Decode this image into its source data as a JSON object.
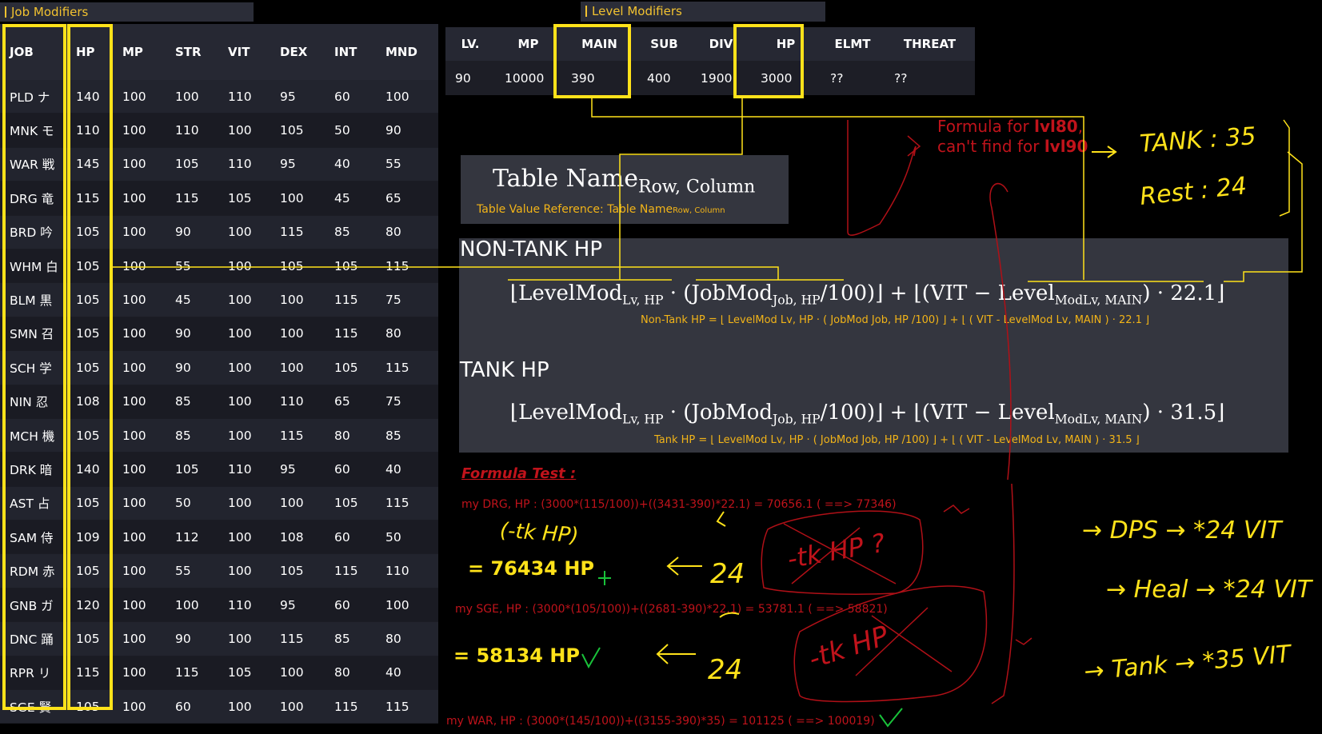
{
  "job_panel": {
    "title": "Job Modifiers",
    "columns": [
      "JOB",
      "HP",
      "MP",
      "STR",
      "VIT",
      "DEX",
      "INT",
      "MND"
    ],
    "rows": [
      [
        "PLD ナ",
        "140",
        "100",
        "100",
        "110",
        "95",
        "60",
        "100"
      ],
      [
        "MNK モ",
        "110",
        "100",
        "110",
        "100",
        "105",
        "50",
        "90"
      ],
      [
        "WAR 戦",
        "145",
        "100",
        "105",
        "110",
        "95",
        "40",
        "55"
      ],
      [
        "DRG 竜",
        "115",
        "100",
        "115",
        "105",
        "100",
        "45",
        "65"
      ],
      [
        "BRD 吟",
        "105",
        "100",
        "90",
        "100",
        "115",
        "85",
        "80"
      ],
      [
        "WHM 白",
        "105",
        "100",
        "55",
        "100",
        "105",
        "105",
        "115"
      ],
      [
        "BLM 黒",
        "105",
        "100",
        "45",
        "100",
        "100",
        "115",
        "75"
      ],
      [
        "SMN 召",
        "105",
        "100",
        "90",
        "100",
        "100",
        "115",
        "80"
      ],
      [
        "SCH 学",
        "105",
        "100",
        "90",
        "100",
        "100",
        "105",
        "115"
      ],
      [
        "NIN 忍",
        "108",
        "100",
        "85",
        "100",
        "110",
        "65",
        "75"
      ],
      [
        "MCH 機",
        "105",
        "100",
        "85",
        "100",
        "115",
        "80",
        "85"
      ],
      [
        "DRK 暗",
        "140",
        "100",
        "105",
        "110",
        "95",
        "60",
        "40"
      ],
      [
        "AST 占",
        "105",
        "100",
        "50",
        "100",
        "100",
        "105",
        "115"
      ],
      [
        "SAM 侍",
        "109",
        "100",
        "112",
        "100",
        "108",
        "60",
        "50"
      ],
      [
        "RDM 赤",
        "105",
        "100",
        "55",
        "100",
        "105",
        "115",
        "110"
      ],
      [
        "GNB ガ",
        "120",
        "100",
        "100",
        "110",
        "95",
        "60",
        "100"
      ],
      [
        "DNC 踊",
        "105",
        "100",
        "90",
        "100",
        "115",
        "85",
        "80"
      ],
      [
        "RPR リ",
        "115",
        "100",
        "115",
        "105",
        "100",
        "80",
        "40"
      ],
      [
        "SGE 賢",
        "105",
        "100",
        "60",
        "100",
        "100",
        "115",
        "115"
      ]
    ]
  },
  "level_panel": {
    "title": "Level Modifiers",
    "columns": [
      "LV.",
      "MP",
      "MAIN",
      "SUB",
      "DIV",
      "HP",
      "ELMT",
      "THREAT"
    ],
    "row": [
      "90",
      "10000",
      "390",
      "400",
      "1900",
      "3000",
      "??",
      "??"
    ]
  },
  "legend_panel": {
    "name": "Table Name",
    "subscript": "Row, Column",
    "ref_label": "Table Value Reference: Table Name",
    "ref_subscript": "Row, Column"
  },
  "nontank": {
    "heading": "NON-TANK HP",
    "plain_formula": "Non-Tank HP = ⌊ LevelMod Lv, HP · ( JobMod Job, HP /100) ⌋ + ⌊ ( VIT - LevelMod Lv, MAIN ) · 22.1 ⌋",
    "constant": "22.1"
  },
  "tank": {
    "heading": "TANK HP",
    "plain_formula": "Tank HP = ⌊ LevelMod Lv, HP · ( JobMod Job, HP /100) ⌋ + ⌊ ( VIT - LevelMod Lv, MAIN ) · 31.5 ⌋",
    "constant": "31.5"
  },
  "formula_terms": {
    "levelmod": "LevelMod",
    "levelmod_sub": "Lv, HP",
    "jobmod": "JobMod",
    "jobmod_sub": "Job, HP",
    "level": "Level",
    "level_sub": "ModLv, MAIN",
    "vit": "VIT"
  },
  "note": {
    "line1_prefix": "Formula for ",
    "line1_bold": "lvl80",
    "line1_suffix": ",",
    "line2_prefix": "can't find for ",
    "line2_bold": "lvl90"
  },
  "test": {
    "heading": "Formula Test :",
    "drg": "my DRG, HP : (3000*(115/100))+((3431-390)*22.1) = 70656.1 ( ==> 77346)",
    "sge": "my SGE, HP : (3000*(105/100))+((2681-390)*22.1) = 53781.1 ( ==> 58821)",
    "war": "my WAR, HP : (3000*(145/100))+((3155-390)*35) = 101125 ( ==> 100019)",
    "result1_value": "76434",
    "result2_value": "58134"
  },
  "handwriting": {
    "tank": "TANK : 35",
    "rest": "Rest : 24",
    "tk_hp": "(-tk HP)",
    "hp1": "= 76434 HP",
    "hp2": "= 58134 HP",
    "arrow_num": "24",
    "dps": "→ DPS → *24 VIT",
    "heal": "→ Heal → *24 VIT",
    "tankline": "→ Tank → *35 VIT",
    "cross1": "-tk HP ?",
    "cross2": "-tk HP"
  },
  "colors": {
    "accent_yellow": "#ffe21a",
    "gold": "#f2b418",
    "red": "#c0131b",
    "panel": "#34363f",
    "check_green": "#19c23a"
  }
}
